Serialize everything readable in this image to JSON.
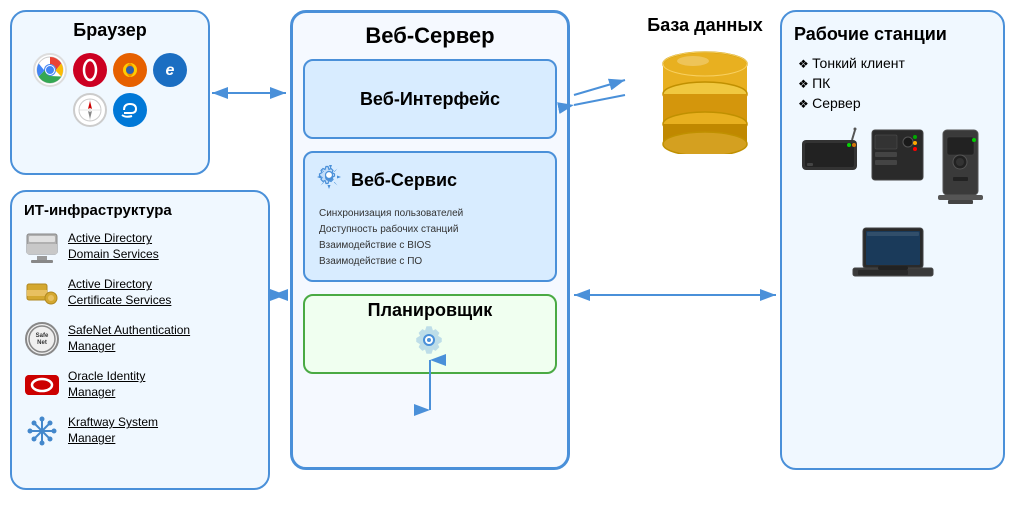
{
  "browser": {
    "title": "Браузер",
    "icons": [
      "Chrome",
      "Opera",
      "Firefox",
      "IE",
      "Safari",
      "Edge"
    ]
  },
  "it_infra": {
    "title": "ИТ-инфраструктура",
    "items": [
      {
        "icon_type": "ad",
        "line1": "Active Directory",
        "line2": "Domain Services"
      },
      {
        "icon_type": "ad2",
        "line1": "Active Directory",
        "line2": "Certificate Services"
      },
      {
        "icon_type": "safenet",
        "line1": "SafeNet Authentication",
        "line2": "Manager"
      },
      {
        "icon_type": "oracle",
        "line1": "Oracle Identity",
        "line2": "Manager"
      },
      {
        "icon_type": "kraftway",
        "line1": "Kraftway System",
        "line2": "Manager"
      }
    ]
  },
  "webserver": {
    "title": "Веб-Сервер",
    "web_interface": {
      "label": "Веб-Интерфейс"
    },
    "web_service": {
      "label": "Веб-Сервис",
      "features": [
        "Синхронизация пользователей",
        "Доступность рабочих станций",
        "Взаимодействие с BIOS",
        "Взаимодействие с ПО"
      ]
    },
    "scheduler": {
      "label": "Планировщик"
    }
  },
  "database": {
    "title": "База данных"
  },
  "workstations": {
    "title": "Рабочие станции",
    "items": [
      "Тонкий клиент",
      "ПК",
      "Сервер"
    ]
  },
  "arrows": {
    "color": "#4a90d9"
  }
}
